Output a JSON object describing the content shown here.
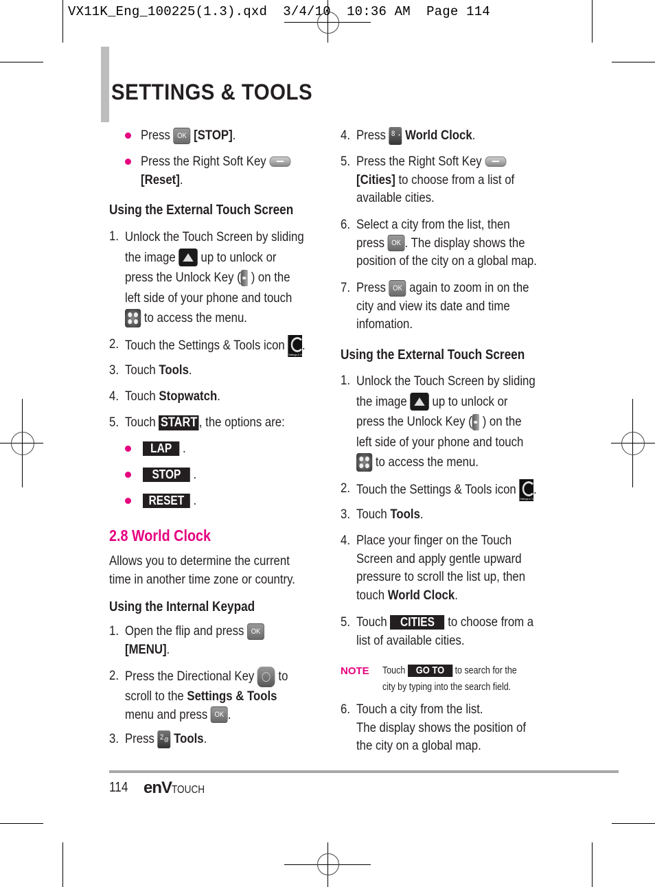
{
  "print_slug": "VX11K_Eng_100225(1.3).qxd  3/4/10  10:36 AM  Page 114",
  "header": {
    "title": "SETTINGS & TOOLS"
  },
  "left_column": {
    "bullets_top": [
      {
        "pre": "Press",
        "icon": "ok-key-icon",
        "bold": "[STOP]",
        "post": "."
      },
      {
        "pre": "Press the Right Soft Key",
        "icon": "right-soft-key-icon",
        "bold": "[Reset]",
        "post": "."
      }
    ],
    "ext_heading": "Using the External Touch Screen",
    "ext_steps": {
      "s1_num": "1.",
      "s1_l1": "Unlock the Touch Screen by sliding",
      "s1_l2a": "the image",
      "s1_l2b": "up to unlock or",
      "s1_l3a": "press the Unlock Key (",
      "s1_l3b": ") on the",
      "s1_l4": "left side of your phone and touch",
      "s1_l5": "to access the menu.",
      "s2_num": "2.",
      "s2_text": "Touch the Settings & Tools icon",
      "s2_post": ".",
      "s3_num": "3.",
      "s3_pre": "Touch",
      "s3_bold": "Tools",
      "s3_post": ".",
      "s4_num": "4.",
      "s4_pre": "Touch",
      "s4_bold": "Stopwatch",
      "s4_post": ".",
      "s5_num": "5.",
      "s5_pre": "Touch",
      "s5_btn": "START",
      "s5_post": ", the options are:"
    },
    "options": [
      {
        "label": "LAP",
        "post": "."
      },
      {
        "label": "STOP",
        "post": "."
      },
      {
        "label": "RESET",
        "post": "."
      }
    ],
    "section_title": "2.8 World Clock",
    "section_desc_l1": "Allows you to determine the current",
    "section_desc_l2": "time in another time zone or country.",
    "int_heading": "Using the Internal Keypad",
    "int_steps": {
      "s1_num": "1.",
      "s1_text": "Open the flip and press",
      "s1_bold": "[MENU]",
      "s1_post": ".",
      "s2_num": "2.",
      "s2_l1a": "Press the Directional Key",
      "s2_l1b": "to",
      "s2_l2a": "scroll to the",
      "s2_l2b": "Settings & Tools",
      "s2_l3": "menu and press",
      "s2_l3_post": ".",
      "s3_num": "3.",
      "s3_pre": "Press",
      "s3_key": "2",
      "s3_key_sup": "@",
      "s3_bold": "Tools",
      "s3_post": "."
    }
  },
  "right_column": {
    "int_steps_cont": {
      "s4_num": "4.",
      "s4_pre": "Press",
      "s4_key": "8",
      "s4_key_sup": "*",
      "s4_bold": "World Clock",
      "s4_post": ".",
      "s5_num": "5.",
      "s5_l1": "Press the Right Soft Key",
      "s5_bold": "[Cities]",
      "s5_l2": "to choose from a list of",
      "s5_l3": "available cities.",
      "s6_num": "6.",
      "s6_l1": "Select a city from the list, then",
      "s6_l2a": "press",
      "s6_l2b": ". The display shows the",
      "s6_l3": "position of the city on a global map.",
      "s7_num": "7.",
      "s7_l1a": "Press",
      "s7_l1b": "again to zoom in on the",
      "s7_l2": "city and view its date and time",
      "s7_l3": "infomation."
    },
    "ext_heading": "Using the External Touch Screen",
    "ext_steps": {
      "s1_num": "1.",
      "s1_l1": "Unlock the Touch Screen by sliding",
      "s1_l2a": "the image",
      "s1_l2b": "up to unlock or",
      "s1_l3a": "press the Unlock Key (",
      "s1_l3b": ") on the",
      "s1_l4": "left side of your phone and touch",
      "s1_l5": "to access the menu.",
      "s2_num": "2.",
      "s2_text": "Touch the Settings & Tools icon",
      "s2_post": ".",
      "s3_num": "3.",
      "s3_pre": "Touch",
      "s3_bold": "Tools",
      "s3_post": ".",
      "s4_num": "4.",
      "s4_l1": "Place your finger on the Touch",
      "s4_l2": "Screen and apply gentle upward",
      "s4_l3": "pressure to scroll the list up, then",
      "s4_l4a": "touch",
      "s4_l4b": "World Clock",
      "s4_l4c": ".",
      "s5_num": "5.",
      "s5_pre": "Touch",
      "s5_btn": "CITIES",
      "s5_l1b": "to choose from a",
      "s5_l2": "list of available cities.",
      "s6_num": "6.",
      "s6_l1": "Touch a city from the list.",
      "s6_l2": "The display shows the position of",
      "s6_l3": "the city on a global map."
    },
    "note": {
      "label": "NOTE",
      "pre": "Touch",
      "btn": "GO TO",
      "l1b": "to search for the",
      "l2": "city by typing into the search field."
    }
  },
  "footer": {
    "page_number": "114",
    "brand_main": "enV",
    "brand_sub": "TOUCH"
  },
  "colors": {
    "accent": "#e6007e",
    "text": "#231f20",
    "bar": "#bdbdbd",
    "button_bg": "#231f20"
  }
}
